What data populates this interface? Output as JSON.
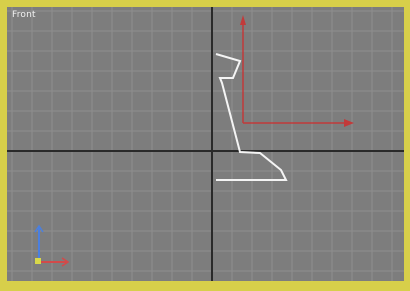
{
  "viewport": {
    "label": "Front",
    "active_border_color": "#d7cf4a",
    "background_color": "#7d7d7d",
    "grid_color": "#8f8f8f",
    "axis_color": "#2a2a2a"
  },
  "scene": {
    "selected_shape": "white polyline profile (lathe spline)",
    "gizmo": {
      "icon": "transform-gizmo-icon",
      "x_axis_color": "#c23a3a",
      "y_axis_color": "#c23a3a"
    }
  },
  "axis_tripod": {
    "icon": "axis-tripod-icon",
    "x_color": "#d24a4a",
    "y_color": "#4a7fe0",
    "origin_color": "#d8d84a"
  }
}
